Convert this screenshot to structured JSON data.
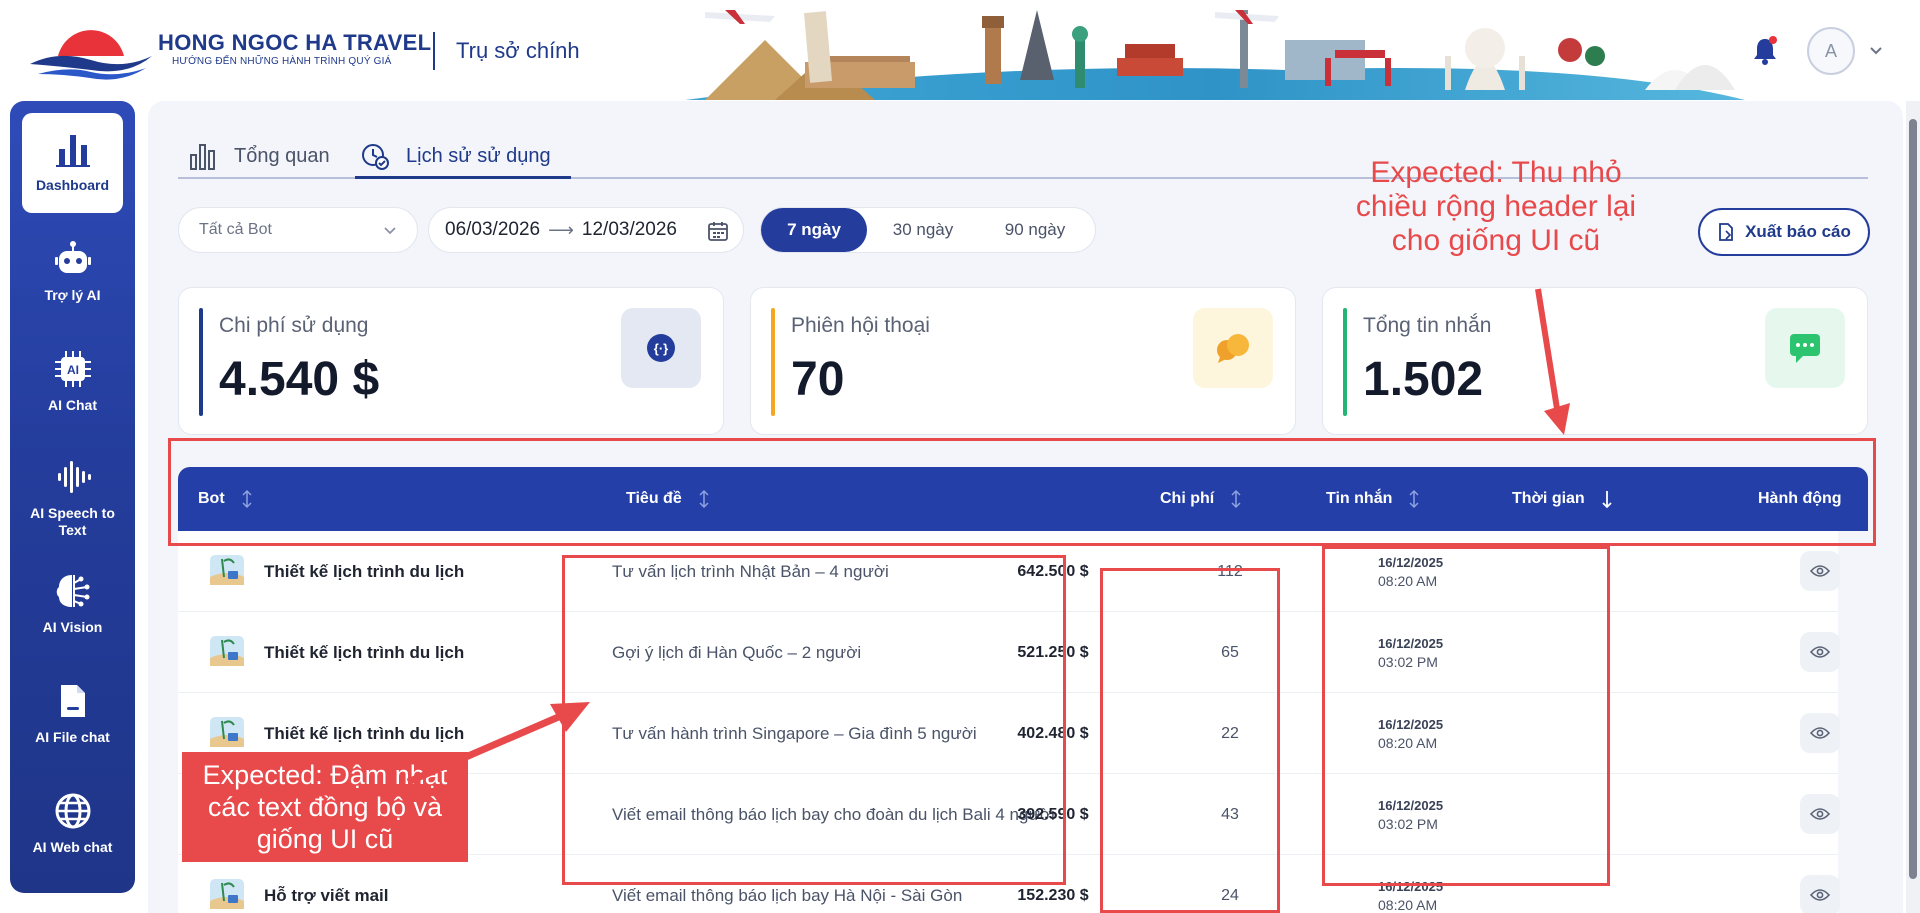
{
  "header": {
    "brand_name": "HONG NGOC HA TRAVEL",
    "brand_slogan": "HƯỚNG ĐẾN NHỮNG HÀNH TRÌNH QUÝ GIÁ",
    "branch": "Trụ sở chính",
    "avatar_initial": "A"
  },
  "sidebar": {
    "items": [
      {
        "label": "Dashboard",
        "icon": "bar-chart-icon"
      },
      {
        "label": "Trợ lý AI",
        "icon": "robot-icon"
      },
      {
        "label": "AI Chat",
        "icon": "ai-chip-icon"
      },
      {
        "label": "AI Speech to Text",
        "icon": "sound-wave-icon"
      },
      {
        "label": "AI Vision",
        "icon": "brain-icon"
      },
      {
        "label": "AI File chat",
        "icon": "file-icon"
      },
      {
        "label": "AI Web chat",
        "icon": "globe-icon"
      }
    ]
  },
  "tabs": [
    {
      "label": "Tổng quan"
    },
    {
      "label": "Lịch sử sử dụng"
    }
  ],
  "filters": {
    "bot_select": "Tất cả Bot",
    "date_from": "06/03/2026",
    "date_to": "12/03/2026",
    "periods": [
      "7 ngày",
      "30 ngày",
      "90 ngày"
    ],
    "export_label": "Xuất báo cáo"
  },
  "stats": [
    {
      "label": "Chi phí sử dụng",
      "value": "4.540 $",
      "accent": "#1f3a8a"
    },
    {
      "label": "Phiên hội thoại",
      "value": "70",
      "accent": "#f5a623"
    },
    {
      "label": "Tổng tin nhắn",
      "value": "1.502",
      "accent": "#22b573"
    }
  ],
  "table": {
    "columns": [
      "Bot",
      "Tiêu đề",
      "Chi phí",
      "Tin nhắn",
      "Thời gian",
      "Hành động"
    ],
    "rows": [
      {
        "bot": "Thiết kế lịch trình du lịch",
        "title": "Tư vấn lịch trình Nhật Bản – 4 người",
        "cost": "642.500 $",
        "messages": "112",
        "date": "16/12/2025",
        "time": "08:20 AM"
      },
      {
        "bot": "Thiết kế lịch trình du lịch",
        "title": "Gợi ý lịch đi Hàn Quốc – 2 người",
        "cost": "521.250 $",
        "messages": "65",
        "date": "16/12/2025",
        "time": "03:02 PM"
      },
      {
        "bot": "Thiết kế lịch trình du lịch",
        "title": "Tư vấn hành trình Singapore – Gia đình 5 người",
        "cost": "402.480 $",
        "messages": "22",
        "date": "16/12/2025",
        "time": "08:20 AM"
      },
      {
        "bot": "",
        "title": "Viết email thông báo lịch bay cho đoàn du lịch Bali 4 người",
        "cost": "392.590 $",
        "messages": "43",
        "date": "16/12/2025",
        "time": "03:02 PM"
      },
      {
        "bot": "Hỗ trợ viết mail",
        "title": "Viết email thông báo lịch bay Hà Nội - Sài Gòn",
        "cost": "152.230 $",
        "messages": "24",
        "date": "16/12/2025",
        "time": "08:20 AM"
      }
    ]
  },
  "annotations": {
    "header_note": "Expected: Thu nhỏ chiều rộng header lại cho giống UI cũ",
    "text_note": "Expected: Đậm nhạt các text đồng bộ và giống UI cũ"
  }
}
